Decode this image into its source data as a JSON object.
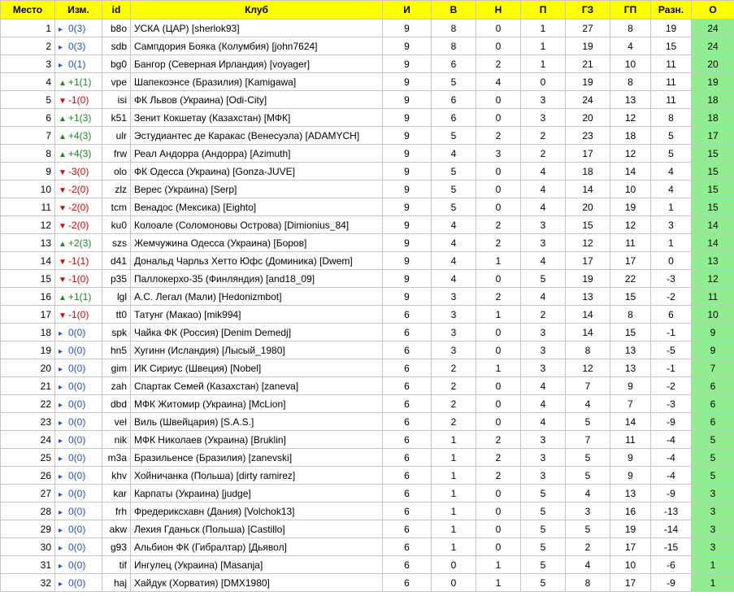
{
  "headers": [
    "Место",
    "Изм.",
    "id",
    "Клуб",
    "И",
    "В",
    "Н",
    "П",
    "ГЗ",
    "ГП",
    "Разн.",
    "О"
  ],
  "colors": {
    "header_bg": "#ffff00",
    "points_bg": "#90ee90",
    "up": "#1a8a1a",
    "down": "#e00000",
    "same": "#2050c8"
  },
  "rows": [
    {
      "place": "1",
      "dir": "same",
      "arrow": "▸",
      "change": "0(3)",
      "id": "b8o",
      "club": "УСКА (ЦАР) [sherlok93]",
      "p": "9",
      "w": "8",
      "d": "0",
      "l": "1",
      "gf": "27",
      "ga": "8",
      "diff": "19",
      "pts": "24"
    },
    {
      "place": "2",
      "dir": "same",
      "arrow": "▸",
      "change": "0(3)",
      "id": "sdb",
      "club": "Сампдория Бояка (Колумбия) [john7624]",
      "p": "9",
      "w": "8",
      "d": "0",
      "l": "1",
      "gf": "19",
      "ga": "4",
      "diff": "15",
      "pts": "24"
    },
    {
      "place": "3",
      "dir": "same",
      "arrow": "▸",
      "change": "0(1)",
      "id": "bg0",
      "club": "Бангор (Северная Ирландия) [voyager]",
      "p": "9",
      "w": "6",
      "d": "2",
      "l": "1",
      "gf": "21",
      "ga": "10",
      "diff": "11",
      "pts": "20"
    },
    {
      "place": "4",
      "dir": "up",
      "arrow": "▲",
      "change": "+1(1)",
      "id": "vpe",
      "club": "Шапекоэнсе (Бразилия) [Kamigawa]",
      "p": "9",
      "w": "5",
      "d": "4",
      "l": "0",
      "gf": "19",
      "ga": "8",
      "diff": "11",
      "pts": "19"
    },
    {
      "place": "5",
      "dir": "down",
      "arrow": "▼",
      "change": "-1(0)",
      "id": "isi",
      "club": "ФК Львов (Украина) [Odi-City]",
      "p": "9",
      "w": "6",
      "d": "0",
      "l": "3",
      "gf": "24",
      "ga": "13",
      "diff": "11",
      "pts": "18"
    },
    {
      "place": "6",
      "dir": "up",
      "arrow": "▲",
      "change": "+1(3)",
      "id": "k51",
      "club": "Зенит Кокшетау (Казахстан) [МФК]",
      "p": "9",
      "w": "6",
      "d": "0",
      "l": "3",
      "gf": "20",
      "ga": "12",
      "diff": "8",
      "pts": "18"
    },
    {
      "place": "7",
      "dir": "up",
      "arrow": "▲",
      "change": "+4(3)",
      "id": "ulr",
      "club": "Эстудиантес де Каракас (Венесуэла) [ADAMYCH]",
      "p": "9",
      "w": "5",
      "d": "2",
      "l": "2",
      "gf": "23",
      "ga": "18",
      "diff": "5",
      "pts": "17"
    },
    {
      "place": "8",
      "dir": "up",
      "arrow": "▲",
      "change": "+4(3)",
      "id": "frw",
      "club": "Реал Андорра (Андорра) [Azimuth]",
      "p": "9",
      "w": "4",
      "d": "3",
      "l": "2",
      "gf": "17",
      "ga": "12",
      "diff": "5",
      "pts": "15"
    },
    {
      "place": "9",
      "dir": "down",
      "arrow": "▼",
      "change": "-3(0)",
      "id": "olo",
      "club": "ФК Одесса (Украина) [Gonza-JUVE]",
      "p": "9",
      "w": "5",
      "d": "0",
      "l": "4",
      "gf": "18",
      "ga": "14",
      "diff": "4",
      "pts": "15"
    },
    {
      "place": "10",
      "dir": "down",
      "arrow": "▼",
      "change": "-2(0)",
      "id": "zlz",
      "club": "Верес (Украина) [Serp]",
      "p": "9",
      "w": "5",
      "d": "0",
      "l": "4",
      "gf": "14",
      "ga": "10",
      "diff": "4",
      "pts": "15"
    },
    {
      "place": "11",
      "dir": "down",
      "arrow": "▼",
      "change": "-2(0)",
      "id": "tcm",
      "club": "Венадос (Мексика) [Eighto]",
      "p": "9",
      "w": "5",
      "d": "0",
      "l": "4",
      "gf": "20",
      "ga": "19",
      "diff": "1",
      "pts": "15"
    },
    {
      "place": "12",
      "dir": "down",
      "arrow": "▼",
      "change": "-2(0)",
      "id": "ku0",
      "club": "Колоале (Соломоновы Острова) [Dimionius_84]",
      "p": "9",
      "w": "4",
      "d": "2",
      "l": "3",
      "gf": "15",
      "ga": "12",
      "diff": "3",
      "pts": "14"
    },
    {
      "place": "13",
      "dir": "up",
      "arrow": "▲",
      "change": "+2(3)",
      "id": "szs",
      "club": "Жемчужина Одесса (Украина) [Боров]",
      "p": "9",
      "w": "4",
      "d": "2",
      "l": "3",
      "gf": "12",
      "ga": "11",
      "diff": "1",
      "pts": "14"
    },
    {
      "place": "14",
      "dir": "down",
      "arrow": "▼",
      "change": "-1(1)",
      "id": "d41",
      "club": "Дональд Чарльз Хетто Юфс (Доминика) [Dwem]",
      "p": "9",
      "w": "4",
      "d": "1",
      "l": "4",
      "gf": "17",
      "ga": "17",
      "diff": "0",
      "pts": "13"
    },
    {
      "place": "15",
      "dir": "down",
      "arrow": "▼",
      "change": "-1(0)",
      "id": "p35",
      "club": "Паллокерхо-35 (Финляндия) [and18_09]",
      "p": "9",
      "w": "4",
      "d": "0",
      "l": "5",
      "gf": "19",
      "ga": "22",
      "diff": "-3",
      "pts": "12"
    },
    {
      "place": "16",
      "dir": "up",
      "arrow": "▲",
      "change": "+1(1)",
      "id": "lgl",
      "club": "А.С. Легал (Мали) [Hedonizmbot]",
      "p": "9",
      "w": "3",
      "d": "2",
      "l": "4",
      "gf": "13",
      "ga": "15",
      "diff": "-2",
      "pts": "11"
    },
    {
      "place": "17",
      "dir": "down",
      "arrow": "▼",
      "change": "-1(0)",
      "id": "tt0",
      "club": "Татунг (Макао) [mik994]",
      "p": "6",
      "w": "3",
      "d": "1",
      "l": "2",
      "gf": "14",
      "ga": "8",
      "diff": "6",
      "pts": "10"
    },
    {
      "place": "18",
      "dir": "same",
      "arrow": "▸",
      "change": "0(0)",
      "id": "spk",
      "club": "Чайка ФК (Россия) [Denim Demedj]",
      "p": "6",
      "w": "3",
      "d": "0",
      "l": "3",
      "gf": "14",
      "ga": "15",
      "diff": "-1",
      "pts": "9"
    },
    {
      "place": "19",
      "dir": "same",
      "arrow": "▸",
      "change": "0(0)",
      "id": "hn5",
      "club": "Хугинн (Исландия) [Лысый_1980]",
      "p": "6",
      "w": "3",
      "d": "0",
      "l": "3",
      "gf": "8",
      "ga": "13",
      "diff": "-5",
      "pts": "9"
    },
    {
      "place": "20",
      "dir": "same",
      "arrow": "▸",
      "change": "0(0)",
      "id": "gim",
      "club": "ИК Сириус (Швеция) [Nobel]",
      "p": "6",
      "w": "2",
      "d": "1",
      "l": "3",
      "gf": "12",
      "ga": "13",
      "diff": "-1",
      "pts": "7"
    },
    {
      "place": "21",
      "dir": "same",
      "arrow": "▸",
      "change": "0(0)",
      "id": "zah",
      "club": "Спартак Семей (Казахстан) [zaneva]",
      "p": "6",
      "w": "2",
      "d": "0",
      "l": "4",
      "gf": "7",
      "ga": "9",
      "diff": "-2",
      "pts": "6"
    },
    {
      "place": "22",
      "dir": "same",
      "arrow": "▸",
      "change": "0(0)",
      "id": "dbd",
      "club": "МФК Житомир (Украина) [McLion]",
      "p": "6",
      "w": "2",
      "d": "0",
      "l": "4",
      "gf": "4",
      "ga": "7",
      "diff": "-3",
      "pts": "6"
    },
    {
      "place": "23",
      "dir": "same",
      "arrow": "▸",
      "change": "0(0)",
      "id": "vel",
      "club": "Виль (Швейцария) [S.A.S.]",
      "p": "6",
      "w": "2",
      "d": "0",
      "l": "4",
      "gf": "5",
      "ga": "14",
      "diff": "-9",
      "pts": "6"
    },
    {
      "place": "24",
      "dir": "same",
      "arrow": "▸",
      "change": "0(0)",
      "id": "nik",
      "club": "МФК Николаев (Украина) [Bruklin]",
      "p": "6",
      "w": "1",
      "d": "2",
      "l": "3",
      "gf": "7",
      "ga": "11",
      "diff": "-4",
      "pts": "5"
    },
    {
      "place": "25",
      "dir": "same",
      "arrow": "▸",
      "change": "0(0)",
      "id": "m3a",
      "club": "Бразильенсе (Бразилия) [zanevski]",
      "p": "6",
      "w": "1",
      "d": "2",
      "l": "3",
      "gf": "5",
      "ga": "9",
      "diff": "-4",
      "pts": "5"
    },
    {
      "place": "26",
      "dir": "same",
      "arrow": "▸",
      "change": "0(0)",
      "id": "khv",
      "club": "Хойничанка (Польша) [dirty ramirez]",
      "p": "6",
      "w": "1",
      "d": "2",
      "l": "3",
      "gf": "5",
      "ga": "9",
      "diff": "-4",
      "pts": "5"
    },
    {
      "place": "27",
      "dir": "same",
      "arrow": "▸",
      "change": "0(0)",
      "id": "kar",
      "club": "Карпаты (Украина) [judge]",
      "p": "6",
      "w": "1",
      "d": "0",
      "l": "5",
      "gf": "4",
      "ga": "13",
      "diff": "-9",
      "pts": "3"
    },
    {
      "place": "28",
      "dir": "same",
      "arrow": "▸",
      "change": "0(0)",
      "id": "frh",
      "club": "Фредериксхавн (Дания) [Volchok13]",
      "p": "6",
      "w": "1",
      "d": "0",
      "l": "5",
      "gf": "3",
      "ga": "16",
      "diff": "-13",
      "pts": "3"
    },
    {
      "place": "29",
      "dir": "same",
      "arrow": "▸",
      "change": "0(0)",
      "id": "akw",
      "club": "Лехия Гданьск (Польша) [Castillo]",
      "p": "6",
      "w": "1",
      "d": "0",
      "l": "5",
      "gf": "5",
      "ga": "19",
      "diff": "-14",
      "pts": "3"
    },
    {
      "place": "30",
      "dir": "same",
      "arrow": "▸",
      "change": "0(0)",
      "id": "g93",
      "club": "Альбион ФК (Гибралтар) [Дьявол]",
      "p": "6",
      "w": "1",
      "d": "0",
      "l": "5",
      "gf": "2",
      "ga": "17",
      "diff": "-15",
      "pts": "3"
    },
    {
      "place": "31",
      "dir": "same",
      "arrow": "▸",
      "change": "0(0)",
      "id": "tif",
      "club": "Ингулец (Украина) [Masanja]",
      "p": "6",
      "w": "0",
      "d": "1",
      "l": "5",
      "gf": "4",
      "ga": "10",
      "diff": "-6",
      "pts": "1"
    },
    {
      "place": "32",
      "dir": "same",
      "arrow": "▸",
      "change": "0(0)",
      "id": "haj",
      "club": "Хайдук (Хорватия) [DMX1980]",
      "p": "6",
      "w": "0",
      "d": "1",
      "l": "5",
      "gf": "8",
      "ga": "17",
      "diff": "-9",
      "pts": "1"
    }
  ]
}
